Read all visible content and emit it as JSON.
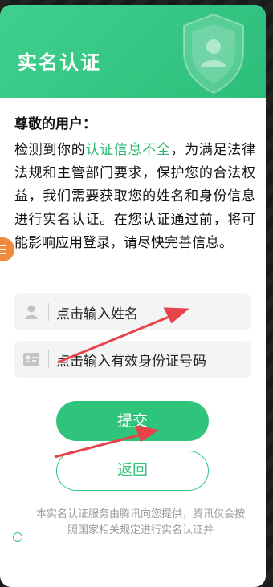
{
  "header": {
    "title": "实名认证"
  },
  "content": {
    "greeting": "尊敬的用户：",
    "para_prefix": "检测到你的",
    "para_highlight": "认证信息不全",
    "para_suffix": "，为满足法律法规和主管部门要求，保护您的合法权益，我们需要获取您的姓名和身份信息进行实名认证。在您认证通过前，将可能影响应用登录，请尽快完善信息。"
  },
  "form": {
    "name_placeholder": "点击输入姓名",
    "id_placeholder": "点击输入有效身份证号码"
  },
  "buttons": {
    "submit": "提交",
    "back": "返回"
  },
  "footer": {
    "text": "本实名认证服务由腾讯向您提供，腾讯仅会按照国家相关规定进行实名认证并"
  },
  "colors": {
    "accent": "#2fc47b",
    "annotation_arrow": "#e8434b",
    "float_button": "#f08a3c"
  }
}
